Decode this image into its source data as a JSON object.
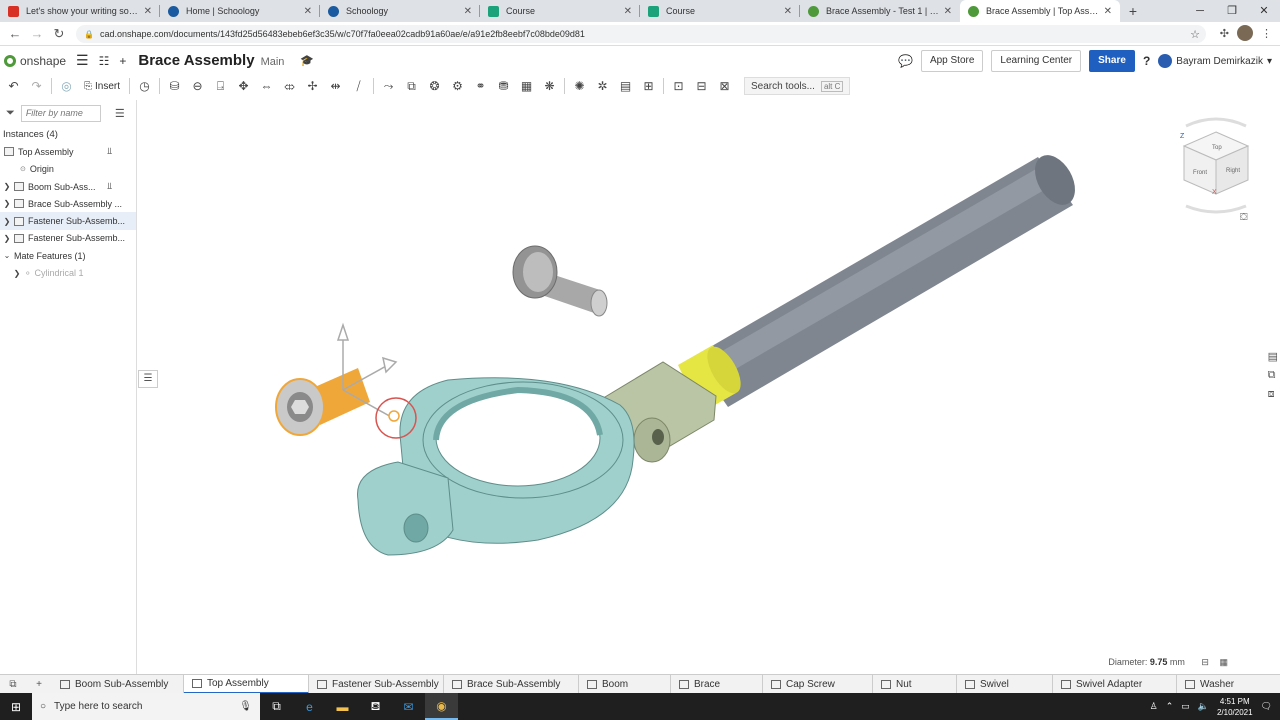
{
  "browser": {
    "tabs": [
      {
        "label": "Let's show your writing some",
        "icon_color": "#d93025"
      },
      {
        "label": "Home | Schoology",
        "icon_color": "#1a5aa0"
      },
      {
        "label": "Schoology",
        "icon_color": "#1a5aa0"
      },
      {
        "label": "Course",
        "icon_color": "#1aa37a"
      },
      {
        "label": "Course",
        "icon_color": "#1aa37a"
      },
      {
        "label": "Brace Assembly - Test 1 | Top As",
        "icon_color": "#4e9a3a"
      },
      {
        "label": "Brace Assembly | Top Assembly",
        "icon_color": "#4e9a3a"
      }
    ],
    "url": "cad.onshape.com/documents/143fd25d56483ebeb6ef3c35/w/c70f7fa0eea02cadb91a60ae/e/a91e2fb8eebf7c08bde09d81"
  },
  "header": {
    "logo_text": "onshape",
    "doc_title": "Brace Assembly",
    "branch": "Main",
    "app_store": "App Store",
    "learning_center": "Learning Center",
    "share": "Share",
    "help": "?",
    "user_name": "Bayram Demirkazik"
  },
  "toolbar": {
    "insert_label": "Insert",
    "search_label": "Search tools...",
    "search_shortcut": "alt C"
  },
  "leftpanel": {
    "filter_placeholder": "Filter by name",
    "instances_header": "Instances (4)",
    "top_assembly": "Top Assembly",
    "origin": "Origin",
    "items": [
      "Boom Sub-Ass...",
      "Brace Sub-Assembly ...",
      "Fastener Sub-Assemb...",
      "Fastener Sub-Assemb..."
    ],
    "mate_header": "Mate Features (1)",
    "mate_item": "Cylindrical 1"
  },
  "viewport": {
    "diameter_label": "Diameter:",
    "diameter_value": "9.75",
    "diameter_unit": "mm",
    "viewcube_labels": {
      "top": "Top",
      "front": "Front",
      "right": "Right",
      "z": "Z",
      "x": "X"
    },
    "colors": {
      "brace": "#9fd0cc",
      "boom": "#7f8690",
      "swivel": "#b9c5a5",
      "collar": "#e5e544",
      "selected": "#f0a73a",
      "cap_screw": "#a8a8a8"
    }
  },
  "bottom_tabs": [
    {
      "label": "Boom Sub-Assembly",
      "active": false
    },
    {
      "label": "Top Assembly",
      "active": true
    },
    {
      "label": "Fastener Sub-Assembly",
      "active": false
    },
    {
      "label": "Brace Sub-Assembly",
      "active": false
    },
    {
      "label": "Boom",
      "active": false
    },
    {
      "label": "Brace",
      "active": false
    },
    {
      "label": "Cap Screw",
      "active": false
    },
    {
      "label": "Nut",
      "active": false
    },
    {
      "label": "Swivel",
      "active": false
    },
    {
      "label": "Swivel Adapter",
      "active": false
    },
    {
      "label": "Washer",
      "active": false
    }
  ],
  "taskbar": {
    "search_placeholder": "Type here to search",
    "time": "4:51 PM",
    "date": "2/10/2021"
  }
}
